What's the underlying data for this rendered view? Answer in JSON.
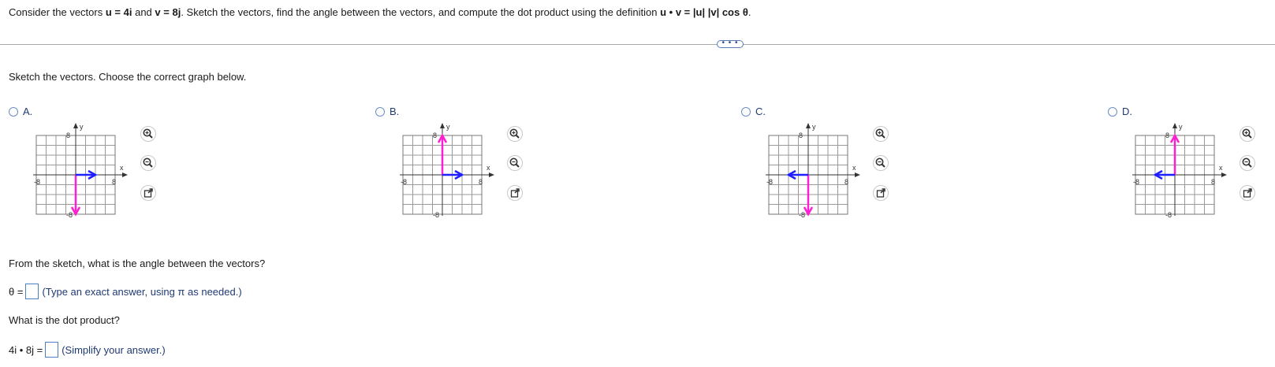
{
  "question": {
    "intro": "Consider the vectors",
    "u_eq": "u = 4i",
    "and": "and",
    "v_eq": "v = 8j",
    "rest": ". Sketch the vectors, find the angle between the vectors, and compute the dot product using the definition",
    "formula": "u • v = |u| |v| cos θ",
    "end": "."
  },
  "more_button": "• • •",
  "prompt": "Sketch the vectors. Choose the correct graph below.",
  "options": [
    {
      "label": "A.",
      "u_dir": "right",
      "v_dir": "down"
    },
    {
      "label": "B.",
      "u_dir": "right",
      "v_dir": "up"
    },
    {
      "label": "C.",
      "u_dir": "left",
      "v_dir": "down"
    },
    {
      "label": "D.",
      "u_dir": "left",
      "v_dir": "up"
    }
  ],
  "graph": {
    "y_label": "y",
    "x_label": "x",
    "tick_pos": "8",
    "tick_neg": "-8",
    "colors": {
      "u": "#1f1fff",
      "v": "#ff1fd2",
      "grid": "#9a9a9a",
      "axis": "#333333"
    }
  },
  "tools": [
    "zoom-in-icon",
    "zoom-out-icon",
    "popout-icon"
  ],
  "angle_question": "From the sketch, what is the angle between the vectors?",
  "theta_prefix": "θ =",
  "theta_hint": "(Type an exact answer, using π as needed.)",
  "dot_question": "What is the dot product?",
  "dot_prefix": "4i • 8j =",
  "dot_hint": "(Simplify your answer.)"
}
